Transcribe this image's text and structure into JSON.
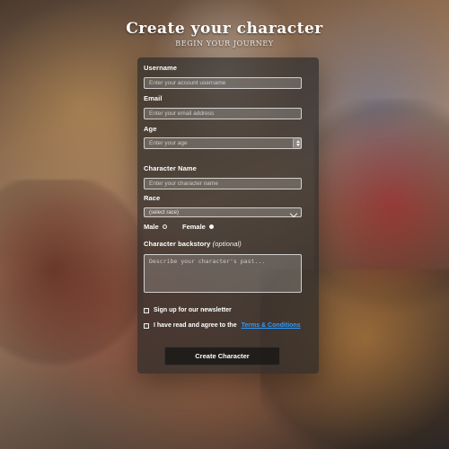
{
  "header": {
    "title": "Create your character",
    "subtitle": "Begin your journey"
  },
  "form": {
    "username": {
      "label": "Username",
      "placeholder": "Enter your account username",
      "value": ""
    },
    "email": {
      "label": "Email",
      "placeholder": "Enter your email address",
      "value": ""
    },
    "age": {
      "label": "Age",
      "placeholder": "Enter your age",
      "value": ""
    },
    "character_name": {
      "label": "Character Name",
      "placeholder": "Enter your character name",
      "value": ""
    },
    "race": {
      "label": "Race",
      "selected": "(select race)"
    },
    "gender": {
      "male_label": "Male",
      "female_label": "Female",
      "selected": "female"
    },
    "backstory": {
      "label": "Character backstory",
      "optional": "(optional)",
      "placeholder": "Describe your character's past...",
      "value": ""
    },
    "newsletter": {
      "label": "Sign up for our newsletter",
      "checked": false
    },
    "terms": {
      "prefix": "I have read and agree to the",
      "link_text": "Terms & Conditions",
      "checked": false
    },
    "submit_label": "Create Character"
  },
  "colors": {
    "panel_bg": "#282828",
    "link": "#2f9bff",
    "text": "#ffffff"
  }
}
